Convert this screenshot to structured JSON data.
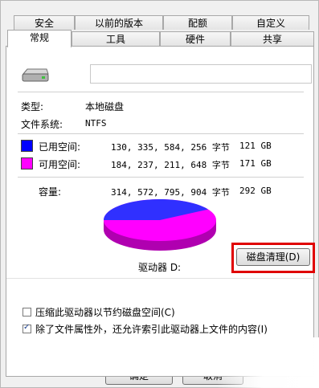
{
  "tabs_row1": [
    "安全",
    "以前的版本",
    "配额",
    "自定义"
  ],
  "tabs_row2": [
    "常规",
    "工具",
    "硬件",
    "共享"
  ],
  "volume_name_value": "",
  "type_label": "类型:",
  "type_value": "本地磁盘",
  "fs_label": "文件系统:",
  "fs_value": "NTFS",
  "used": {
    "label": "已用空间:",
    "bytes": "130, 335, 584, 256 字节",
    "size": "121 GB",
    "color": "#0000ff",
    "fraction": 0.414
  },
  "free": {
    "label": "可用空间:",
    "bytes": "184, 237, 211, 648 字节",
    "size": "171 GB",
    "color": "#ff00ff",
    "fraction": 0.586
  },
  "capacity": {
    "label": "容量:",
    "bytes": "314, 572, 795, 904 字节",
    "size": "292 GB"
  },
  "drive_label": "驱动器 D:",
  "cleanup_button": "磁盘清理(D)",
  "compress_checkbox": {
    "label": "压缩此驱动器以节约磁盘空间(C)",
    "checked": false
  },
  "index_checkbox": {
    "label": "除了文件属性外，还允许索引此驱动器上文件的内容(I)",
    "checked": true
  },
  "ok_button": "确定",
  "cancel_button": "取消",
  "highlight_color": "#e00000"
}
